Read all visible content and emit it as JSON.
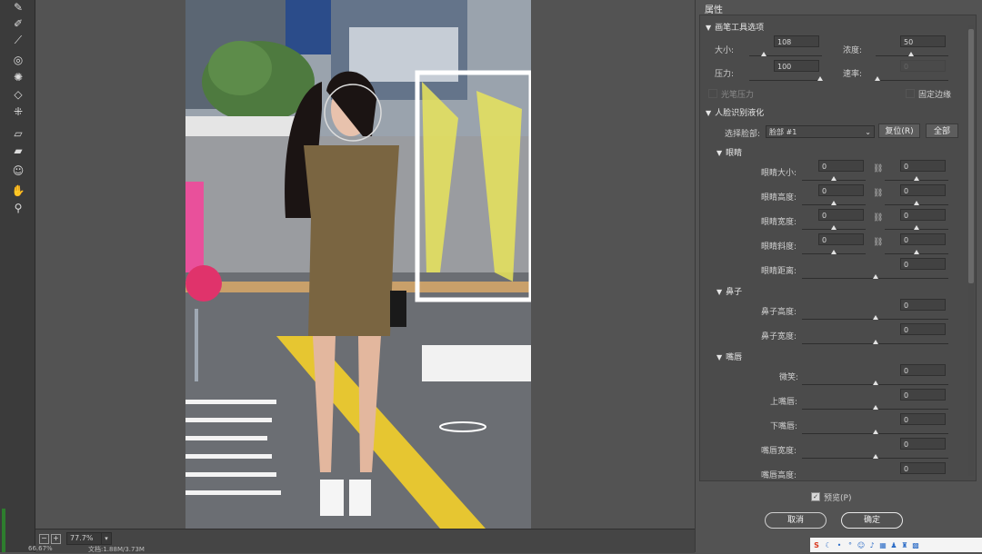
{
  "panel": {
    "title": "属性"
  },
  "brush": {
    "section": "画笔工具选项",
    "size_label": "大小:",
    "size_value": "108",
    "density_label": "浓度:",
    "density_value": "50",
    "pressure_label": "压力:",
    "pressure_value": "100",
    "rate_label": "速率:",
    "rate_value": "0",
    "stylus_label": "光笔压力",
    "pin_edges_label": "固定边缘"
  },
  "face": {
    "section": "人脸识别液化",
    "select_label": "选择脸部:",
    "select_value": "脸部 #1",
    "reset_label": "复位(R)",
    "all_label": "全部",
    "eyes": {
      "section": "眼睛",
      "rows": [
        {
          "label": "眼睛大小:",
          "left": "0",
          "right": "0"
        },
        {
          "label": "眼睛高度:",
          "left": "0",
          "right": "0"
        },
        {
          "label": "眼睛宽度:",
          "left": "0",
          "right": "0"
        },
        {
          "label": "眼睛斜度:",
          "left": "0",
          "right": "0"
        }
      ],
      "distance_label": "眼睛距离:",
      "distance_value": "0"
    },
    "nose": {
      "section": "鼻子",
      "height_label": "鼻子高度:",
      "height_value": "0",
      "width_label": "鼻子宽度:",
      "width_value": "0"
    },
    "mouth": {
      "section": "嘴唇",
      "smile_label": "微笑:",
      "smile_value": "0",
      "upper_label": "上嘴唇:",
      "upper_value": "0",
      "lower_label": "下嘴唇:",
      "lower_value": "0",
      "width_label": "嘴唇宽度:",
      "width_value": "0",
      "height_label": "嘴唇高度:",
      "height_value": "0"
    }
  },
  "preview_label": "预览(P)",
  "cancel_label": "取消",
  "ok_label": "确定",
  "status": {
    "zoom": "77.7%",
    "left_text": "66.67%",
    "doc_text": "文档:1.88M/3.73M"
  },
  "icons": {
    "tools": [
      "forward-warp-icon",
      "reconstruct-icon",
      "smooth-icon",
      "twirl-icon",
      "pucker-icon",
      "bloat-icon",
      "push-left-icon",
      "freeze-mask-icon",
      "thaw-mask-icon",
      "face-tool-icon",
      "hand-icon",
      "zoom-icon"
    ]
  },
  "colors": {
    "bg": "#535353",
    "panel": "#4b4b4b",
    "toolbar": "#3b3b3b"
  }
}
